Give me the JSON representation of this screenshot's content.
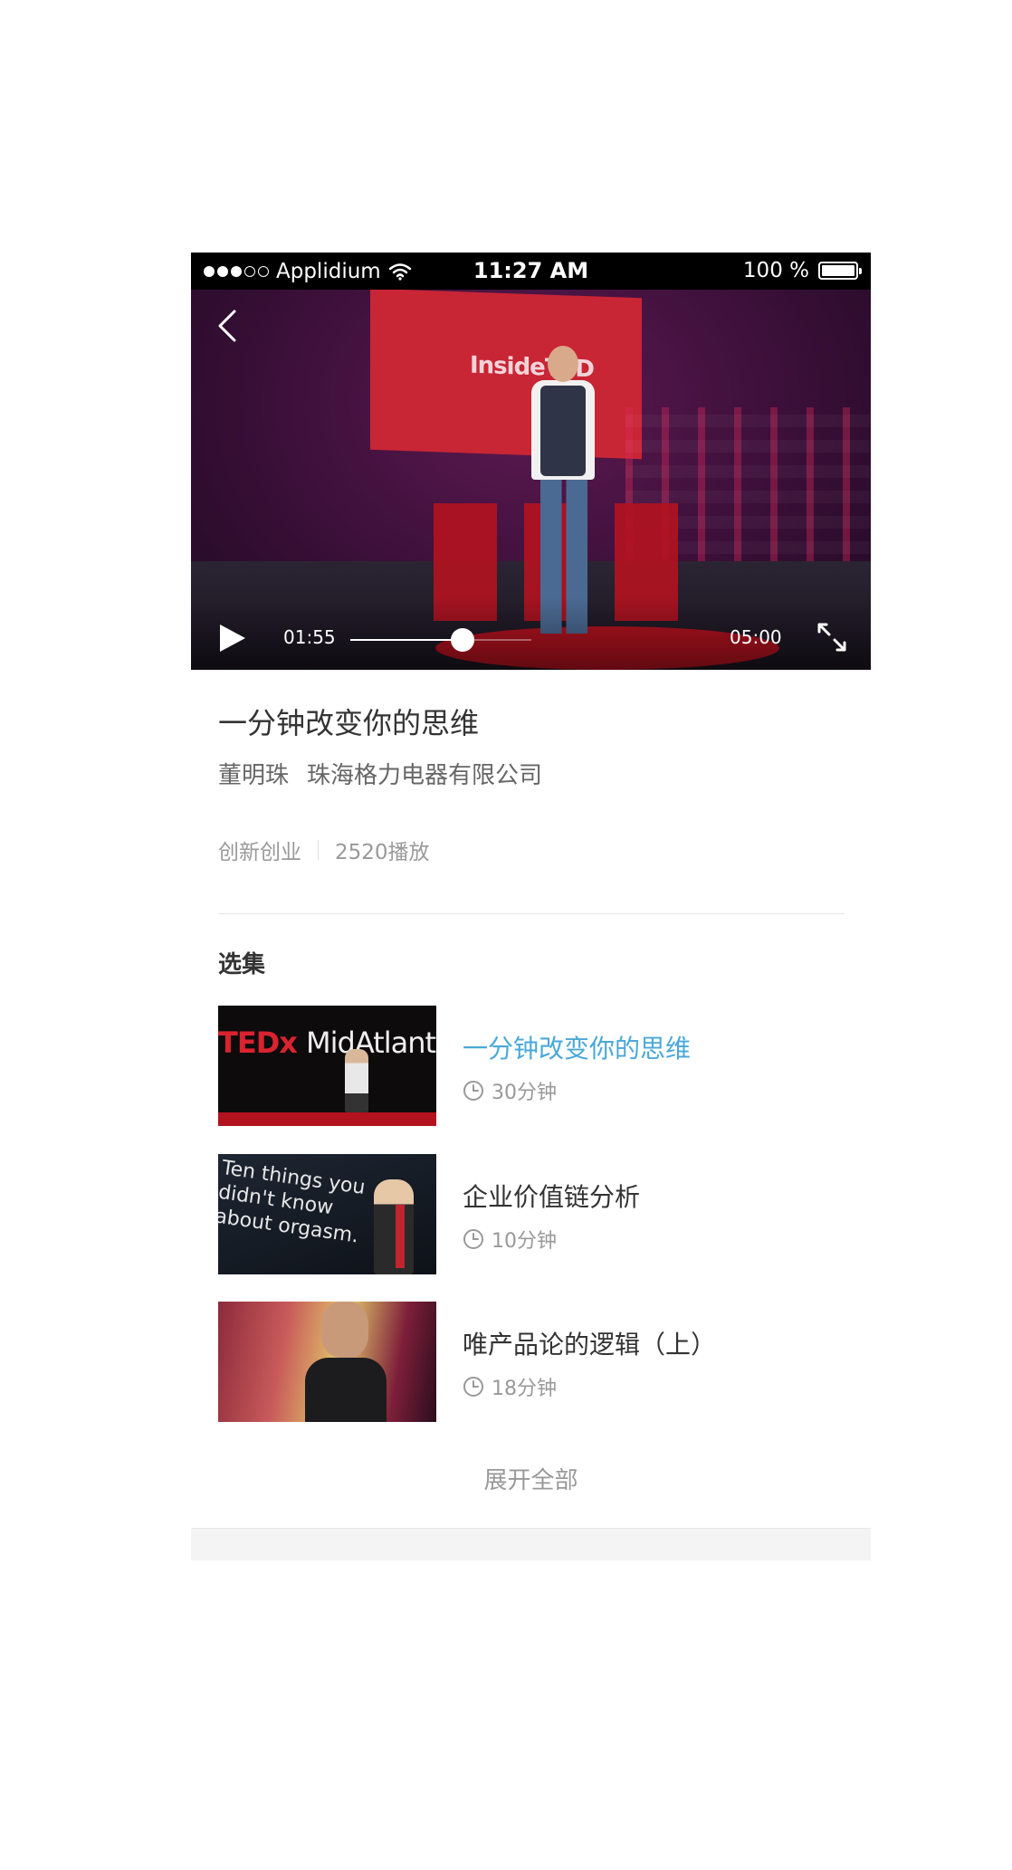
{
  "status_bar": {
    "carrier": "Applidium",
    "time": "11:27 AM",
    "battery_text": "100 %",
    "battery_level": 1.0
  },
  "video": {
    "current_time": "01:55",
    "total_time": "05:00",
    "progress": 0.62,
    "scene_screen_text": "InsideTED"
  },
  "course": {
    "title": "一分钟改变你的思维",
    "speaker": "董明珠",
    "organization": "珠海格力电器有限公司",
    "category": "创新创业",
    "plays": "2520播放"
  },
  "episodes_section": {
    "title": "选集",
    "items": [
      {
        "title": "一分钟改变你的思维",
        "duration": "30分钟",
        "active": true,
        "thumb_text": "TEDx MidAtlantic"
      },
      {
        "title": "企业价值链分析",
        "duration": "10分钟",
        "active": false,
        "thumb_text": "Ten things you didn't know about orgasm."
      },
      {
        "title": "唯产品论的逻辑（上）",
        "duration": "18分钟",
        "active": false,
        "thumb_text": ""
      }
    ],
    "expand_label": "展开全部"
  },
  "colors": {
    "accent": "#4aa8d8",
    "text_primary": "#333333",
    "text_secondary": "#999999"
  },
  "icons": {
    "back": "chevron-left-icon",
    "play": "play-icon",
    "fullscreen": "fullscreen-icon",
    "clock": "clock-icon",
    "wifi": "wifi-icon",
    "battery": "battery-icon"
  }
}
